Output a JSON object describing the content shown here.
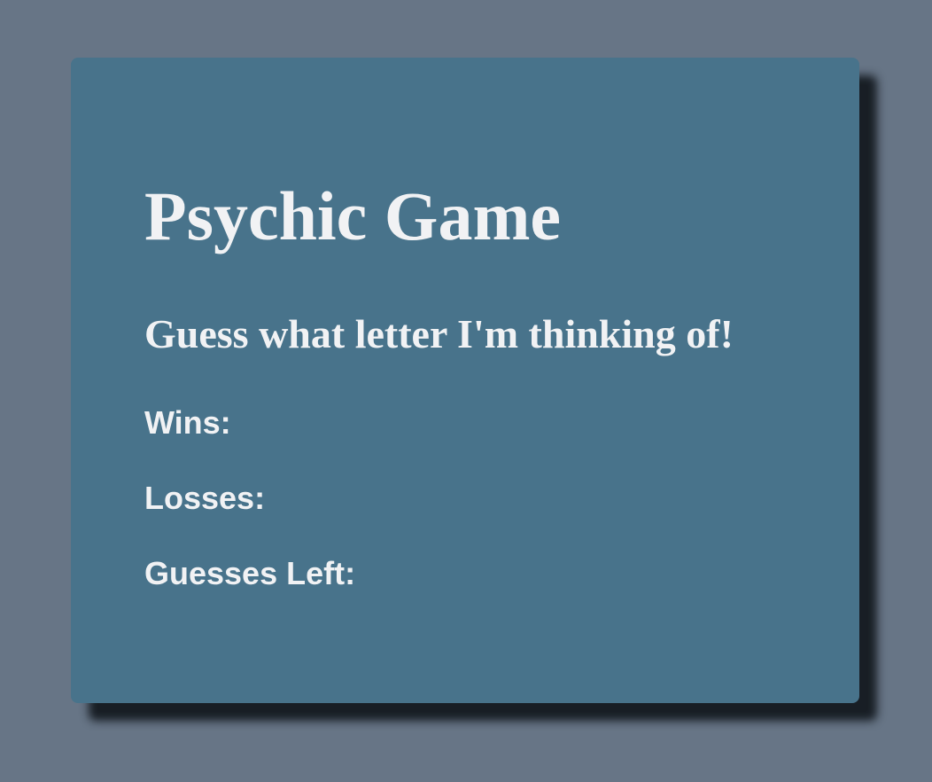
{
  "colors": {
    "page_background": "#677586",
    "card_background": "#48738b",
    "text": "#f1f2f4"
  },
  "game": {
    "title": "Psychic Game",
    "subtitle": "Guess what letter I'm thinking of!",
    "stats": {
      "wins_label": "Wins:",
      "wins_value": "",
      "losses_label": "Losses:",
      "losses_value": "",
      "guesses_left_label": "Guesses Left:",
      "guesses_left_value": ""
    }
  }
}
